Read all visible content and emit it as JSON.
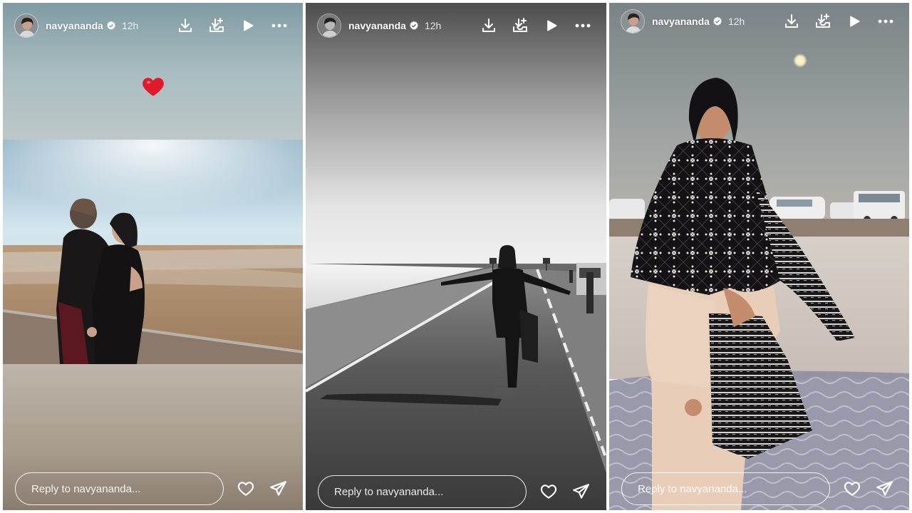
{
  "stories": [
    {
      "username": "navyananda",
      "time": "12h",
      "reply_placeholder": "Reply to navyananda...",
      "sticker": "red-heart-emoji",
      "photo": "two-women-desert-salt-flat"
    },
    {
      "username": "navyananda",
      "time": "12h",
      "reply_placeholder": "Reply to navyananda...",
      "photo": "woman-on-road-black-and-white"
    },
    {
      "username": "navyananda",
      "time": "12h",
      "reply_placeholder": "Reply to navyananda...",
      "photo": "woman-in-shawl-at-dusk"
    }
  ],
  "header_icons": [
    "download-icon",
    "add-to-story-icon",
    "play-icon",
    "more-icon"
  ],
  "footer_icons": [
    "heart-icon",
    "send-icon"
  ],
  "colors": {
    "text": "#ffffff",
    "heart": "#e0192b",
    "verified_badge": "#ffffff"
  }
}
